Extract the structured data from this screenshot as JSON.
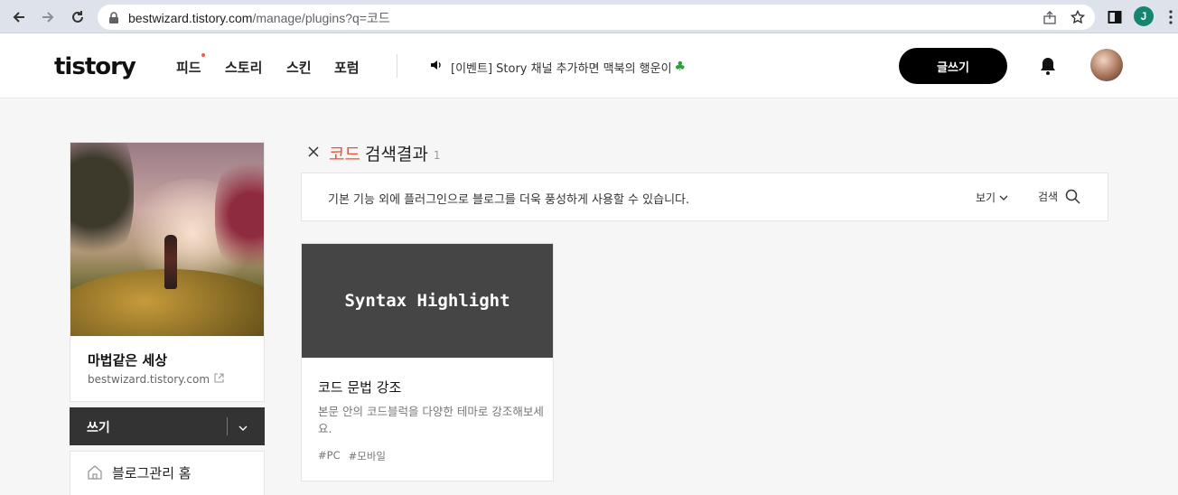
{
  "browser": {
    "url_host": "bestwizard.tistory.com",
    "url_path": "/manage/plugins?q=코드",
    "profile_initial": "J"
  },
  "header": {
    "logo": "tistory",
    "nav": [
      "피드",
      "스토리",
      "스킨",
      "포럼"
    ],
    "notice": "[이벤트] Story 채널 추가하면 맥북의 행운이",
    "write_label": "글쓰기"
  },
  "sidebar": {
    "blog_name": "마법같은 세상",
    "blog_url": "bestwizard.tistory.com",
    "write_label": "쓰기",
    "home_label": "블로그관리 홈"
  },
  "search": {
    "keyword": "코드",
    "result_label": "검색결과",
    "count": "1",
    "description": "기본 기능 외에 플러그인으로 블로그를 더욱 풍성하게 사용할 수 있습니다.",
    "view_label": "보기",
    "search_label": "검색"
  },
  "plugins": [
    {
      "thumb_text": "Syntax Highlight",
      "title": "코드 문법 강조",
      "description": "본문 안의 코드블럭을 다양한 테마로 강조해보세요.",
      "tags": [
        "#PC",
        "#모바일"
      ]
    }
  ],
  "colors": {
    "keyword": "#e8523b",
    "thumb_bg": "#454545"
  }
}
